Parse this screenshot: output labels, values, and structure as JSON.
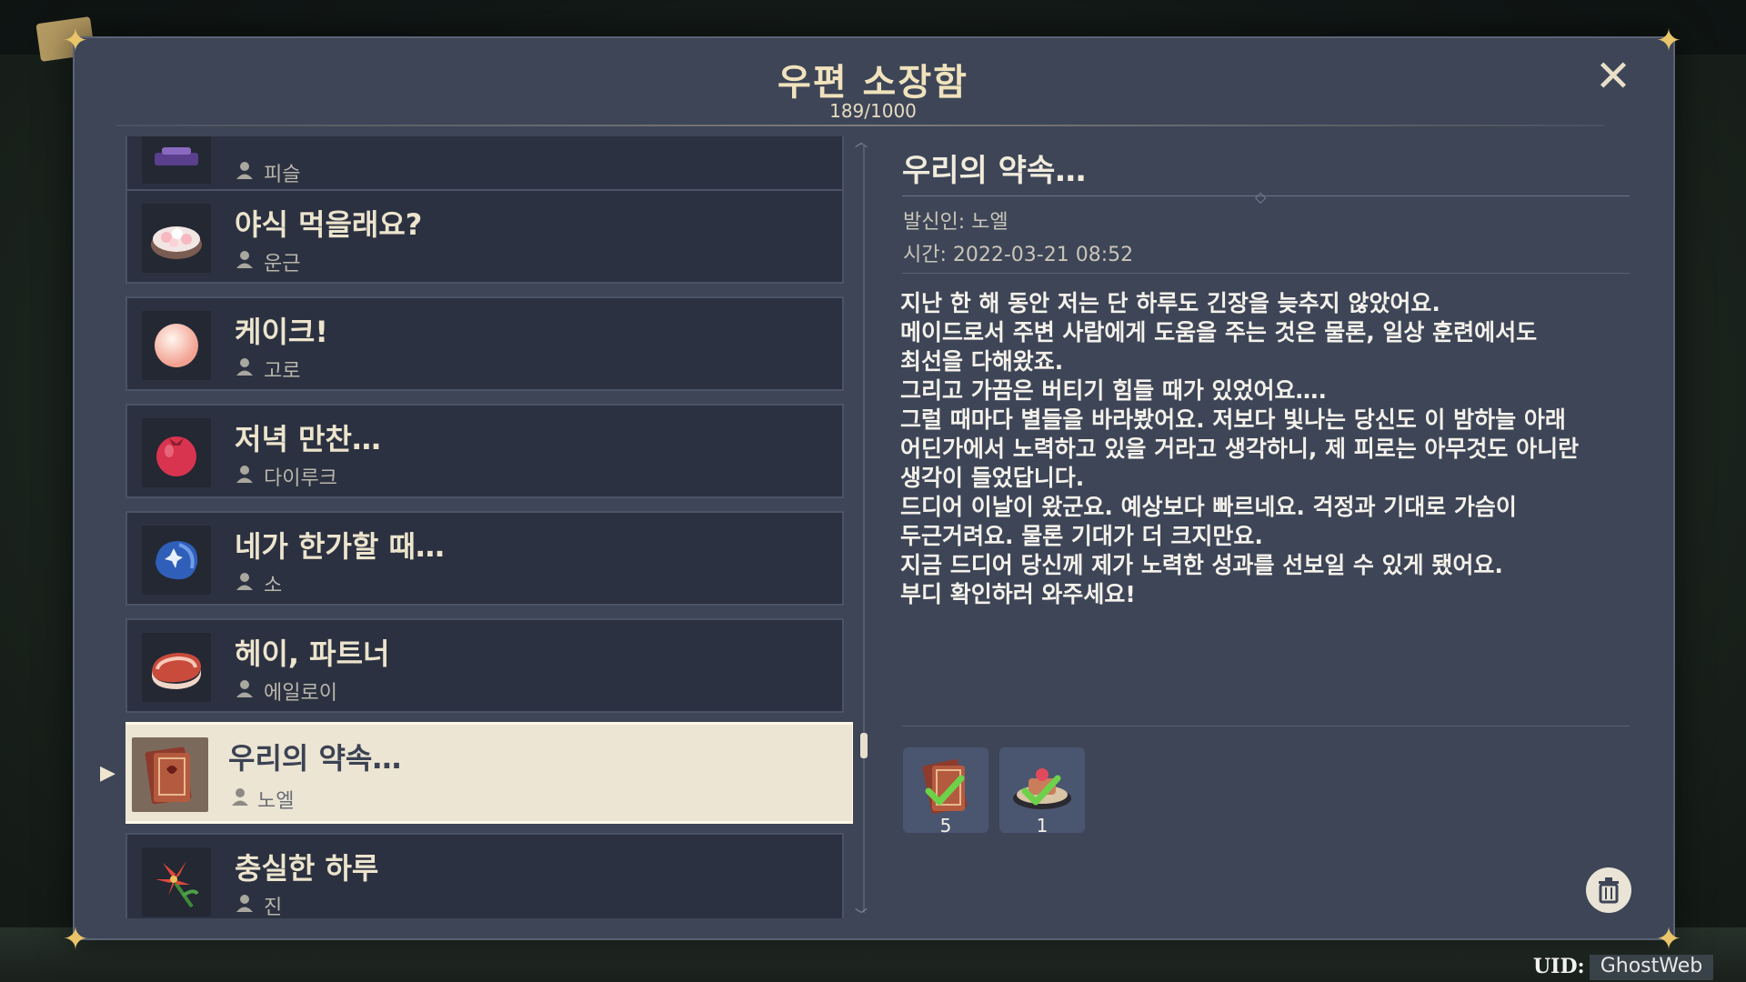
{
  "window": {
    "title": "우편 소장함",
    "count": "189/1000"
  },
  "mail_list": [
    {
      "title": "",
      "sender": "피슬",
      "icon": "purple-box-icon"
    },
    {
      "title": "야식 먹을래요?",
      "sender": "운근",
      "icon": "dumpling-bowl-icon"
    },
    {
      "title": "케이크!",
      "sender": "고로",
      "icon": "pink-pearl-icon"
    },
    {
      "title": "저녁 만찬…",
      "sender": "다이루크",
      "icon": "red-fruit-icon"
    },
    {
      "title": "네가 한가할 때…",
      "sender": "소",
      "icon": "blue-shell-icon"
    },
    {
      "title": "헤이, 파트너",
      "sender": "에일로이",
      "icon": "meat-icon"
    },
    {
      "title": "우리의 약속…",
      "sender": "노엘",
      "icon": "book-icon",
      "selected": true
    },
    {
      "title": "충실한 하루",
      "sender": "진",
      "icon": "flower-icon"
    }
  ],
  "detail": {
    "title": "우리의 약속…",
    "sender": "발신인: 노엘",
    "time": "시간: 2022-03-21 08:52",
    "body": [
      "지난 한 해 동안 저는 단 하루도 긴장을 늦추지 않았어요.",
      "메이드로서 주변 사람에게 도움을 주는 것은 물론, 일상 훈련에서도",
      "최선을 다해왔죠.",
      "그리고 가끔은 버티기 힘들 때가 있었어요….",
      "그럴 때마다 별들을 바라봤어요. 저보다 빛나는 당신도 이 밤하늘 아래",
      "어딘가에서 노력하고 있을 거라고 생각하니, 제 피로는 아무것도 아니란",
      "생각이 들었답니다.",
      "드디어 이날이 왔군요. 예상보다 빠르네요. 걱정과 기대로 가슴이",
      "두근거려요. 물론 기대가 더 크지만요.",
      "지금 드디어 당신께 제가 노력한 성과를 선보일 수 있게 됐어요.",
      "부디 확인하러 와주세요!"
    ],
    "attachments": [
      {
        "qty": "5",
        "icon": "book-icon",
        "claimed": true
      },
      {
        "qty": "1",
        "icon": "cake-plate-icon",
        "claimed": true
      }
    ]
  },
  "footer": {
    "uid_label": "UID:",
    "uid_value": "GhostWeb"
  },
  "colors": {
    "accent": "#e9c46a",
    "panel": "#3d4557",
    "item_bg": "#2b3140",
    "selected_bg": "#ece5d3",
    "check": "#6dd14a"
  }
}
